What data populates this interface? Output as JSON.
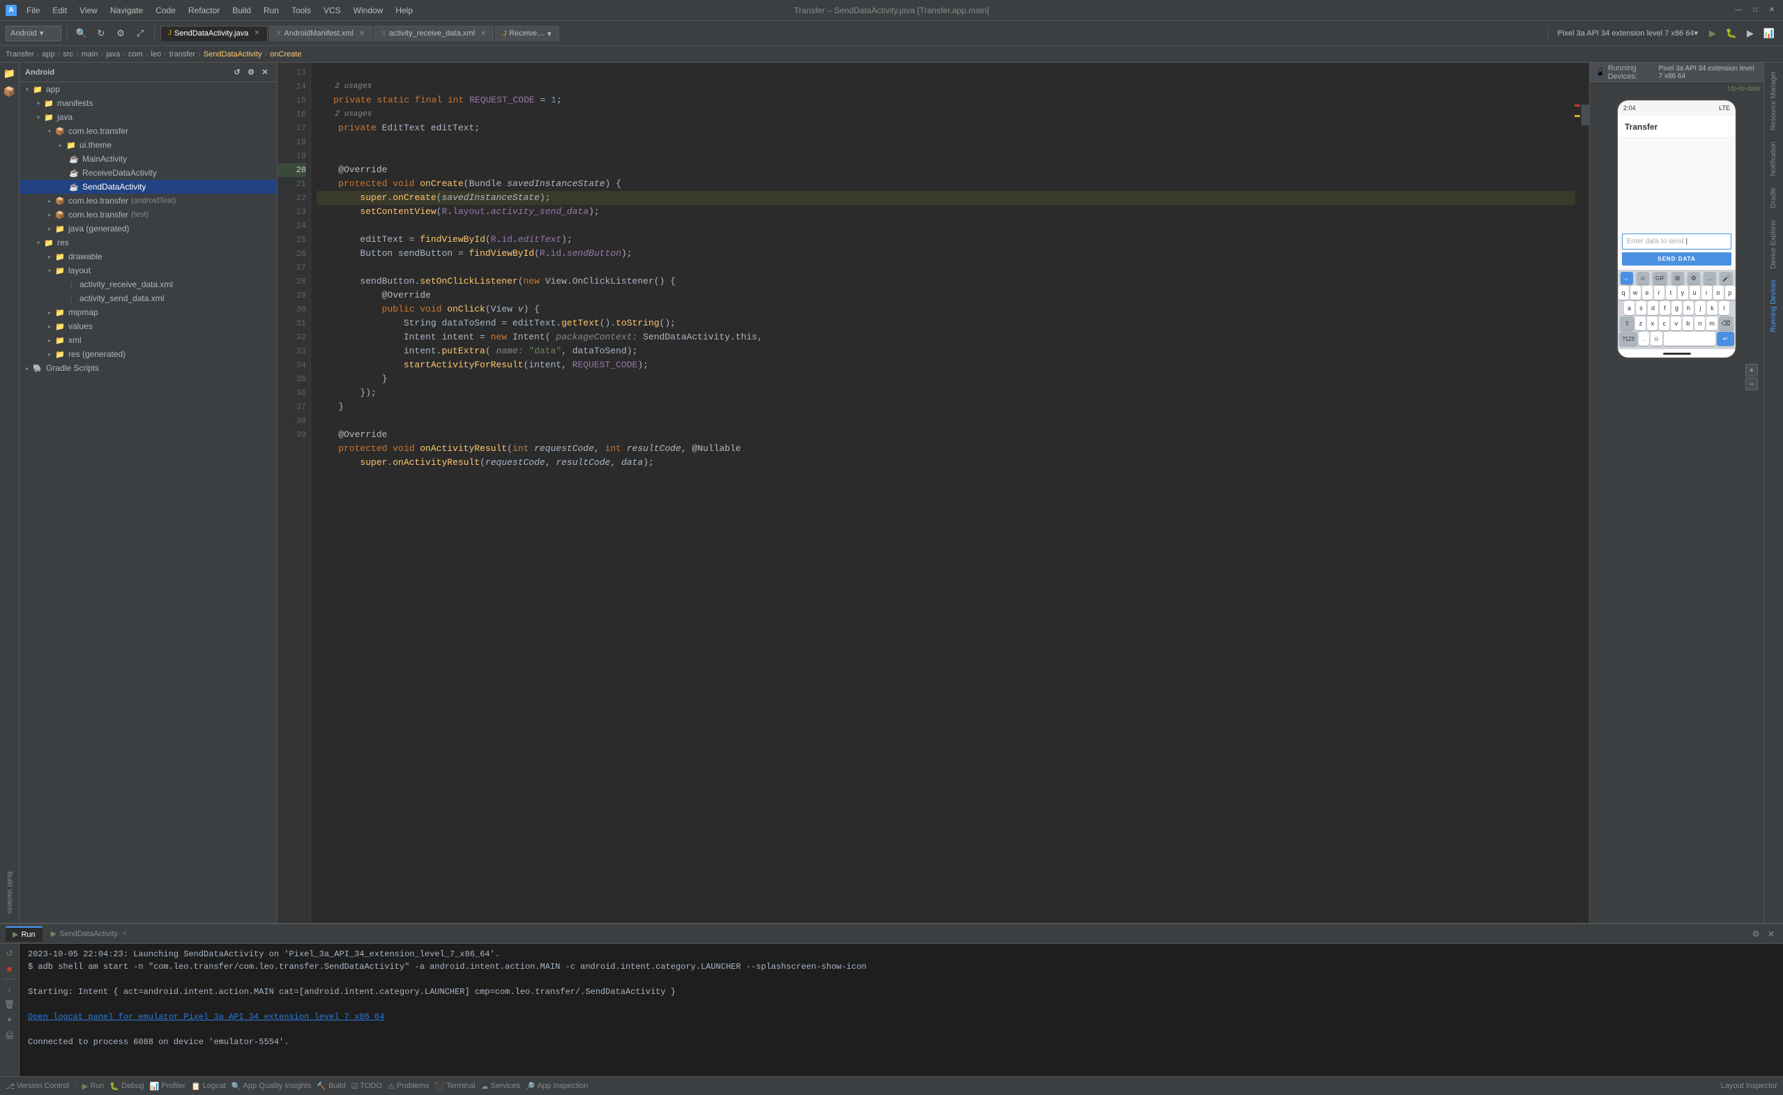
{
  "title_bar": {
    "app_name": "Transfer",
    "file_name": "SendDataActivity.java",
    "window_title": "Transfer – SendDataActivity.java [Transfer.app.main]",
    "menus": [
      "File",
      "Edit",
      "View",
      "Navigate",
      "Code",
      "Refactor",
      "Build",
      "Run",
      "Tools",
      "VCS",
      "Window",
      "Help"
    ],
    "minimize": "—",
    "maximize": "□",
    "close": "✕"
  },
  "breadcrumb": {
    "parts": [
      "Transfer",
      "app",
      "src",
      "main",
      "java",
      "com",
      "leo",
      "transfer"
    ],
    "active_file": "SendDataActivity",
    "active_method": "onCreate"
  },
  "file_tabs": [
    {
      "name": "SendDataActivity.java",
      "type": "java",
      "active": true
    },
    {
      "name": "AndroidManifest.xml",
      "type": "xml",
      "active": false
    },
    {
      "name": "activity_receive_data.xml",
      "type": "xml",
      "active": false
    },
    {
      "name": "Receive…",
      "type": "java",
      "active": false
    }
  ],
  "sidebar": {
    "header": "Android",
    "tree": [
      {
        "level": 0,
        "label": "app",
        "type": "folder",
        "expanded": true
      },
      {
        "level": 1,
        "label": "manifests",
        "type": "folder",
        "expanded": true
      },
      {
        "level": 1,
        "label": "java",
        "type": "folder",
        "expanded": true
      },
      {
        "level": 2,
        "label": "com.leo.transfer",
        "type": "package",
        "expanded": true
      },
      {
        "level": 3,
        "label": "ui.theme",
        "type": "folder",
        "expanded": false
      },
      {
        "level": 3,
        "label": "MainActivity",
        "type": "java",
        "active": false
      },
      {
        "level": 3,
        "label": "ReceiveDataActivity",
        "type": "java",
        "active": false
      },
      {
        "level": 3,
        "label": "SendDataActivity",
        "type": "java",
        "active": true
      },
      {
        "level": 2,
        "label": "com.leo.transfer",
        "sub": "(androidTest)",
        "type": "package",
        "expanded": false
      },
      {
        "level": 2,
        "label": "com.leo.transfer",
        "sub": "(test)",
        "type": "package",
        "expanded": false
      },
      {
        "level": 2,
        "label": "java (generated)",
        "type": "folder",
        "expanded": false
      },
      {
        "level": 1,
        "label": "res",
        "type": "folder",
        "expanded": true
      },
      {
        "level": 2,
        "label": "drawable",
        "type": "folder",
        "expanded": false
      },
      {
        "level": 2,
        "label": "layout",
        "type": "folder",
        "expanded": true
      },
      {
        "level": 3,
        "label": "activity_receive_data.xml",
        "type": "xml"
      },
      {
        "level": 3,
        "label": "activity_send_data.xml",
        "type": "xml"
      },
      {
        "level": 2,
        "label": "mipmap",
        "type": "folder",
        "expanded": false
      },
      {
        "level": 2,
        "label": "values",
        "type": "folder",
        "expanded": false
      },
      {
        "level": 2,
        "label": "xml",
        "type": "folder",
        "expanded": false
      },
      {
        "level": 2,
        "label": "res (generated)",
        "type": "folder",
        "expanded": false
      },
      {
        "level": 0,
        "label": "Gradle Scripts",
        "type": "folder",
        "expanded": false
      }
    ]
  },
  "code": {
    "lines": [
      {
        "num": 13,
        "content": ""
      },
      {
        "num": "",
        "content": "    2 usages"
      },
      {
        "num": 14,
        "content": "    private static final int REQUEST_CODE = 1;"
      },
      {
        "num": "",
        "content": "    2 usages"
      },
      {
        "num": 15,
        "content": "    private EditText editText;"
      },
      {
        "num": 16,
        "content": ""
      },
      {
        "num": 17,
        "content": ""
      },
      {
        "num": 18,
        "content": "    @Override"
      },
      {
        "num": 19,
        "content": "    protected void onCreate(Bundle savedInstanceState) {"
      },
      {
        "num": 20,
        "content": "        super.onCreate(savedInstanceState);"
      },
      {
        "num": 21,
        "content": "        setContentView(R.layout.activity_send_data);"
      },
      {
        "num": 22,
        "content": ""
      },
      {
        "num": 23,
        "content": "        editText = findViewById(R.id.editText);"
      },
      {
        "num": 24,
        "content": "        Button sendButton = findViewById(R.id.sendButton);"
      },
      {
        "num": 25,
        "content": ""
      },
      {
        "num": 26,
        "content": "        sendButton.setOnClickListener(new View.OnClickListener() {"
      },
      {
        "num": 27,
        "content": "            @Override"
      },
      {
        "num": 28,
        "content": "            public void onClick(View v) {"
      },
      {
        "num": 29,
        "content": "                String dataToSend = editText.getText().toString();"
      },
      {
        "num": 30,
        "content": "                Intent intent = new Intent( packageContext: SendDataActivity.this,"
      },
      {
        "num": 31,
        "content": "                intent.putExtra( name: \"data\", dataToSend);"
      },
      {
        "num": 32,
        "content": "                startActivityForResult(intent, REQUEST_CODE);"
      },
      {
        "num": 33,
        "content": "            }"
      },
      {
        "num": 34,
        "content": "        });"
      },
      {
        "num": 35,
        "content": "    }"
      },
      {
        "num": 36,
        "content": ""
      },
      {
        "num": 37,
        "content": "    @Override"
      },
      {
        "num": 38,
        "content": "    protected void onActivityResult(int requestCode, int resultCode, @Nullable"
      },
      {
        "num": 39,
        "content": "        super.onActivityResult(requestCode, resultCode, data);"
      }
    ]
  },
  "running_devices": {
    "label": "Running Devices:",
    "device": "Pixel 3a API 34 extension level 7 x86 64"
  },
  "emulator": {
    "time": "2:04",
    "signal": "LTE",
    "app_title": "Transfer",
    "input_placeholder": "Enter data to send",
    "send_button": "SEND DATA",
    "keyboard": {
      "row1_special": [
        "←",
        "☺",
        "GIF",
        "⊞",
        "⚙",
        "…",
        "🎤"
      ],
      "row2": [
        "q",
        "w",
        "e",
        "r",
        "t",
        "y",
        "u",
        "i",
        "o",
        "p"
      ],
      "row3": [
        "a",
        "s",
        "d",
        "f",
        "g",
        "h",
        "j",
        "k",
        "l"
      ],
      "row4": [
        "⇧",
        "z",
        "x",
        "c",
        "v",
        "b",
        "n",
        "m",
        "⌫"
      ],
      "row5": [
        "?123",
        ".",
        "☺",
        " ",
        "↵"
      ]
    }
  },
  "bottom_panel": {
    "tabs": [
      {
        "label": "Run",
        "active": true,
        "icon": "▶"
      },
      {
        "label": "SendDataActivity",
        "active": true
      }
    ],
    "console": [
      "2023-10-05 22:04:23: Launching SendDataActivity on 'Pixel_3a_API_34_extension_level_7_x86_64'.",
      "$ adb shell am start -n \"com.leo.transfer/com.leo.transfer.SendDataActivity\" -a android.intent.action.MAIN -c android.intent.category.LAUNCHER --splashscreen-show-icon",
      "",
      "Starting: Intent { act=android.intent.action.MAIN cat=[android.intent.category.LAUNCHER] cmp=com.leo.transfer/.SendDataActivity }",
      "",
      "Open logcat panel for emulator Pixel 3a API 34 extension level 7 x86 64",
      "",
      "Connected to process 6088 on device 'emulator-5554'."
    ],
    "link_line": "Open logcat panel for emulator Pixel 3a API 34 extension level 7 x86 64"
  },
  "status_bar": {
    "vcs": "Version Control",
    "run": "Run",
    "debug": "Debug",
    "profiler": "Profiler",
    "logcat": "Logcat",
    "app_quality": "App Quality Insights",
    "build": "Build",
    "todo": "TODO",
    "problems": "Problems",
    "terminal": "Terminal",
    "services": "Services",
    "app_inspection": "App Inspection",
    "right": "Layout Inspector",
    "up_to_date": "Up-to-date"
  },
  "left_panel_icons": [
    {
      "name": "project-icon",
      "glyph": "📁",
      "label": "Project"
    },
    {
      "name": "resource-icon",
      "glyph": "📦",
      "label": "Resource Manager"
    },
    {
      "name": "build-variants-icon",
      "glyph": "⚡",
      "label": "Build Variants"
    }
  ],
  "right_panel_tabs": [
    "Resource Manager",
    "Notification",
    "Gradle",
    "Device Explorer",
    "Running Devices"
  ],
  "build_info": {
    "up_to_date": "Up-to-date"
  }
}
